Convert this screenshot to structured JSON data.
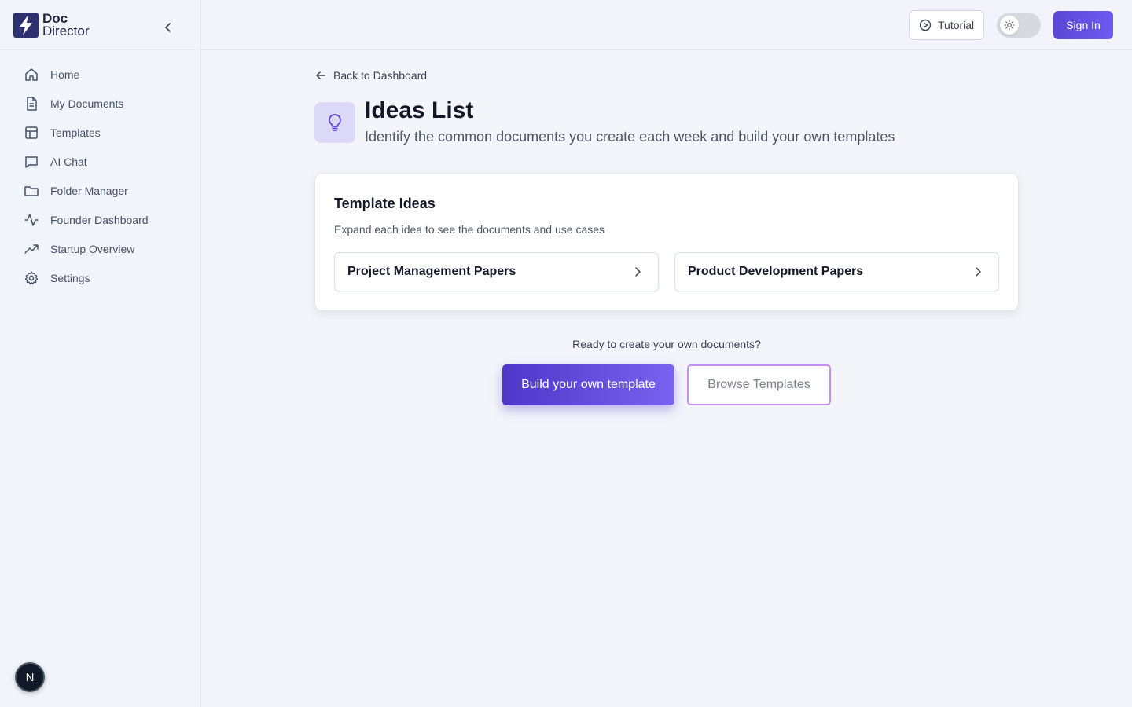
{
  "brand": {
    "line1": "Doc",
    "line2": "Director"
  },
  "sidebar": {
    "items": [
      {
        "label": "Home",
        "icon": "home-icon"
      },
      {
        "label": "My Documents",
        "icon": "document-icon"
      },
      {
        "label": "Templates",
        "icon": "layout-icon"
      },
      {
        "label": "AI Chat",
        "icon": "chat-icon"
      },
      {
        "label": "Folder Manager",
        "icon": "folder-icon"
      },
      {
        "label": "Founder Dashboard",
        "icon": "activity-icon"
      },
      {
        "label": "Startup Overview",
        "icon": "trending-up-icon"
      },
      {
        "label": "Settings",
        "icon": "gear-icon"
      }
    ],
    "avatar_letter": "N"
  },
  "topbar": {
    "tutorial_label": "Tutorial",
    "signin_label": "Sign In"
  },
  "main": {
    "back_label": "Back to Dashboard",
    "title": "Ideas List",
    "subtitle": "Identify the common documents you create each week and build your own templates",
    "card": {
      "title": "Template Ideas",
      "subtitle": "Expand each idea to see the documents and use cases",
      "ideas": [
        {
          "label": "Project Management Papers"
        },
        {
          "label": "Product Development Papers"
        }
      ]
    },
    "ready_text": "Ready to create your own documents?",
    "build_label": "Build your own template",
    "browse_label": "Browse Templates"
  },
  "colors": {
    "accent": "#5b47d6",
    "accent_light": "#dcd8f7",
    "browse_border": "#c48ff0"
  }
}
